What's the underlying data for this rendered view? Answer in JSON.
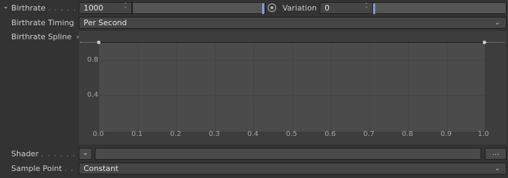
{
  "birthrate": {
    "label": "Birthrate",
    "dots": ". . . . . .",
    "value": "1000",
    "slider_fraction": 0.98,
    "variation_label": "Variation",
    "variation_value": "0",
    "variation_slider_fraction": 0.0
  },
  "birthrate_timing": {
    "label": "Birthrate Timing",
    "value": "Per Second"
  },
  "birthrate_spline": {
    "label": "Birthrate Spline",
    "expand_glyph": "›",
    "y_ticks": [
      "0.8",
      "0.4"
    ],
    "x_ticks": [
      "0.0",
      "0.1",
      "0.2",
      "0.3",
      "0.4",
      "0.5",
      "0.6",
      "0.7",
      "0.8",
      "0.9",
      "1.0"
    ],
    "curve_points": [
      [
        0.0,
        1.0
      ],
      [
        1.0,
        1.0
      ]
    ]
  },
  "shader": {
    "label": "Shader",
    "dots": ". . . . . . .",
    "value": "",
    "more_button": "..."
  },
  "sample_point": {
    "label": "Sample Point",
    "dots": ". .",
    "value": "Constant"
  },
  "colors": {
    "accent": "#7f9fd6",
    "panel": "#333333",
    "field": "#454545",
    "graph": "#4b4b4b"
  }
}
